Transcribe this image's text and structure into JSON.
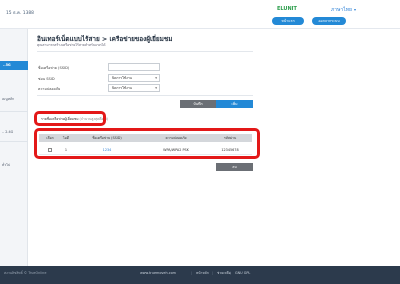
{
  "header": {
    "brand": "ELUNIT",
    "language": "ภาษาไทย",
    "home_button": "หน้าแรก",
    "logout_button": "ออกจากระบบ",
    "device_id": "15 ธ.ค. 1388"
  },
  "sidebar": {
    "items": [
      {
        "label": "..5G"
      },
      {
        "label": "เมนูหลัก"
      },
      {
        "label": ".. 2.4G"
      },
      {
        "label": "ทั่วไป"
      },
      {
        "label": "..."
      }
    ]
  },
  "main": {
    "title": "อินเทอร์เน็ตแบบไร้สาย > เครือข่ายของผู้เยี่ยมชม",
    "description": "คุณสามารถสร้างเครือข่ายไร้สายสำหรับแขกได้",
    "form": {
      "ssid_label": "ชื่อเครือข่าย (SSID)",
      "ssid_value": "",
      "hide_ssid_label": "ซ่อน SSID",
      "hide_ssid_value": "ปิดการใช้งาน",
      "security_label": "ความปลอดภัย",
      "security_value": "ปิดการใช้งาน"
    },
    "buttons": {
      "save": "บันทึก",
      "add": "เพิ่ม",
      "delete": "ลบ"
    },
    "list": {
      "label": "รายชื่อเครือข่ายผู้เยี่ยมชม",
      "note": "(จำนวนสูงสุดคือ 3)",
      "columns": [
        "เลือก",
        "ไอดี",
        "ชื่อเครือข่าย (SSID)",
        "ความปลอดภัย",
        "รหัสผ่าน"
      ],
      "rows": [
        {
          "id": "1",
          "ssid": "1234",
          "security": "WPA/WPA2 PSK",
          "password": "12345678"
        }
      ]
    }
  },
  "footer": {
    "copyright": "สงวนลิขสิทธิ์ © TrueOnline",
    "links": [
      "www.truemoveh.com",
      "หน้าหลัก",
      "ช่วยเหลือ",
      "GNU GPL"
    ]
  },
  "colors": {
    "accent": "#2389d6",
    "highlight": "#e31818",
    "footer_bg": "#2c3a4c"
  }
}
